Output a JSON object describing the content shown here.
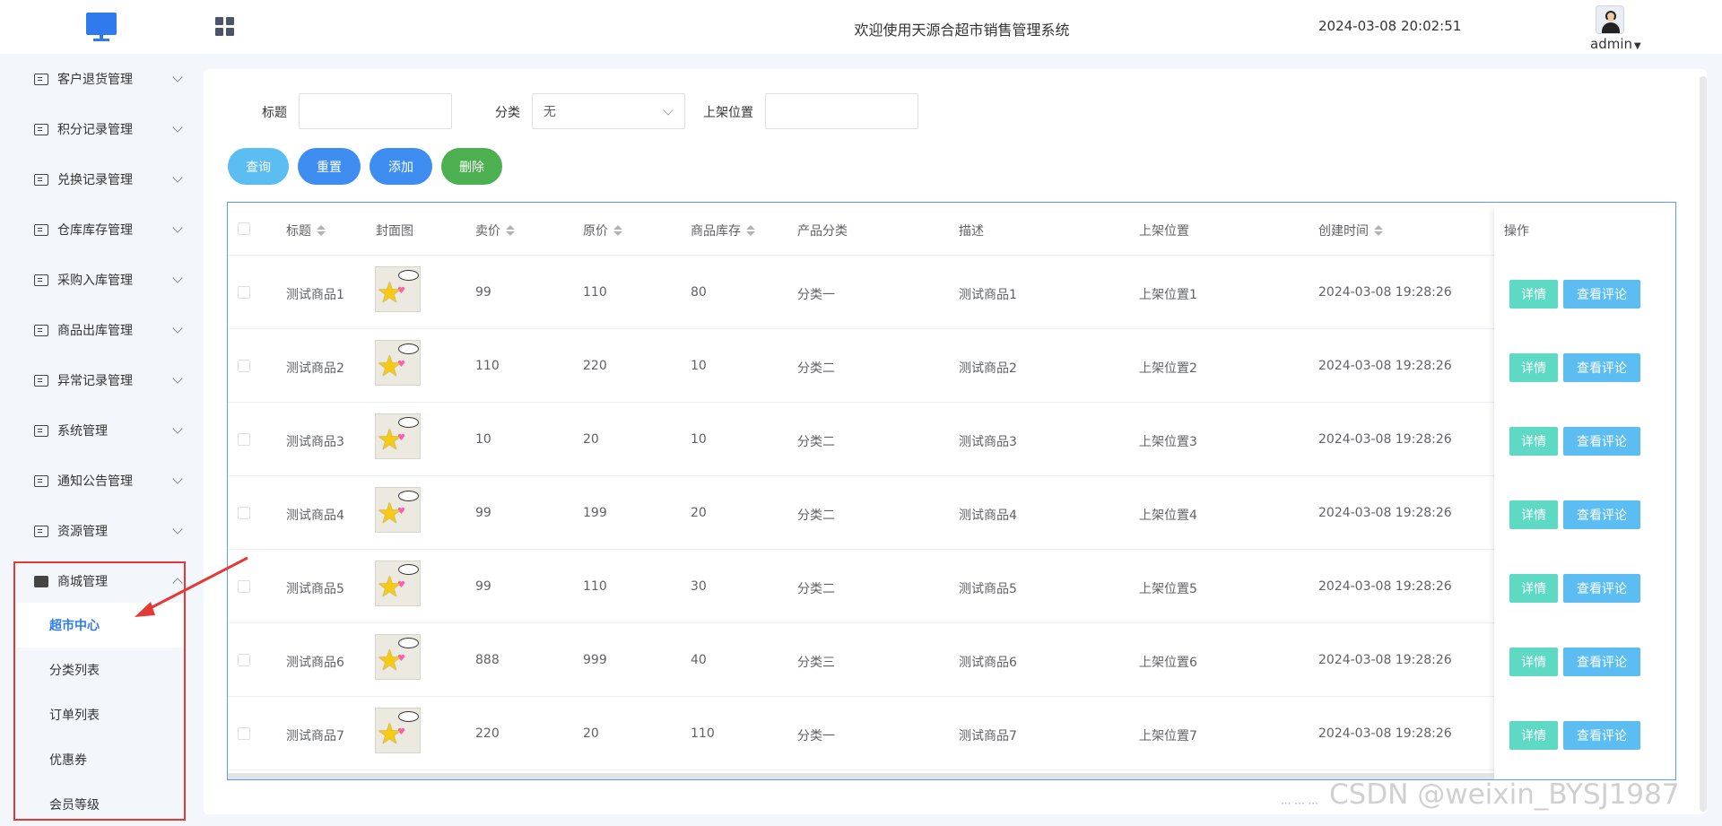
{
  "app": {
    "title": "欢迎使用天源合超市销售管理系统",
    "datetime": "2024-03-08 20:02:51",
    "username": "admin",
    "accent_color": "#2f7bee"
  },
  "sidebar": {
    "items": [
      {
        "label": "客户退货管理",
        "icon": "document-icon"
      },
      {
        "label": "积分记录管理",
        "icon": "document-icon"
      },
      {
        "label": "兑换记录管理",
        "icon": "document-icon"
      },
      {
        "label": "仓库库存管理",
        "icon": "document-icon"
      },
      {
        "label": "采购入库管理",
        "icon": "document-icon"
      },
      {
        "label": "商品出库管理",
        "icon": "document-icon"
      },
      {
        "label": "异常记录管理",
        "icon": "document-icon"
      },
      {
        "label": "系统管理",
        "icon": "folder-icon"
      },
      {
        "label": "通知公告管理",
        "icon": "loading-icon"
      },
      {
        "label": "资源管理",
        "icon": "bowl-icon"
      },
      {
        "label": "商城管理",
        "icon": "shop-icon"
      }
    ],
    "sub_items": [
      {
        "label": "超市中心",
        "active": true
      },
      {
        "label": "分类列表",
        "active": false
      },
      {
        "label": "订单列表",
        "active": false
      },
      {
        "label": "优惠券",
        "active": false
      },
      {
        "label": "会员等级",
        "active": false
      }
    ]
  },
  "filters": {
    "title_label": "标题",
    "title_value": "",
    "category_label": "分类",
    "category_value": "无",
    "position_label": "上架位置",
    "position_value": ""
  },
  "buttons": {
    "query": "查询",
    "reset": "重置",
    "add": "添加",
    "delete": "删除"
  },
  "table": {
    "headers": {
      "title": "标题",
      "cover": "封面图",
      "price": "卖价",
      "original_price": "原价",
      "stock": "商品库存",
      "category": "产品分类",
      "description": "描述",
      "position": "上架位置",
      "created": "创建时间",
      "actions": "操作"
    },
    "rows": [
      {
        "title": "测试商品1",
        "price": "99",
        "original_price": "110",
        "stock": "80",
        "category": "分类一",
        "description": "测试商品1",
        "position": "上架位置1",
        "created": "2024-03-08 19:28:26"
      },
      {
        "title": "测试商品2",
        "price": "110",
        "original_price": "220",
        "stock": "10",
        "category": "分类二",
        "description": "测试商品2",
        "position": "上架位置2",
        "created": "2024-03-08 19:28:26"
      },
      {
        "title": "测试商品3",
        "price": "10",
        "original_price": "20",
        "stock": "10",
        "category": "分类二",
        "description": "测试商品3",
        "position": "上架位置3",
        "created": "2024-03-08 19:28:26"
      },
      {
        "title": "测试商品4",
        "price": "99",
        "original_price": "199",
        "stock": "20",
        "category": "分类二",
        "description": "测试商品4",
        "position": "上架位置4",
        "created": "2024-03-08 19:28:26"
      },
      {
        "title": "测试商品5",
        "price": "99",
        "original_price": "110",
        "stock": "30",
        "category": "分类二",
        "description": "测试商品5",
        "position": "上架位置5",
        "created": "2024-03-08 19:28:26"
      },
      {
        "title": "测试商品6",
        "price": "888",
        "original_price": "999",
        "stock": "40",
        "category": "分类三",
        "description": "测试商品6",
        "position": "上架位置6",
        "created": "2024-03-08 19:28:26"
      },
      {
        "title": "测试商品7",
        "price": "220",
        "original_price": "20",
        "stock": "110",
        "category": "分类一",
        "description": "测试商品7",
        "position": "上架位置7",
        "created": "2024-03-08 19:28:26"
      }
    ],
    "action_detail": "详情",
    "action_comments": "查看评论"
  },
  "watermark": "CSDN @weixin_BYSJ1987",
  "colors": {
    "btn_query": "#5cbdf2",
    "btn_reset": "#3d8ef0",
    "btn_add": "#3d8ef0",
    "btn_delete": "#4caf50",
    "detail": "#5ed9c4",
    "comments": "#5cbdf2",
    "annotation": "#e53935"
  }
}
